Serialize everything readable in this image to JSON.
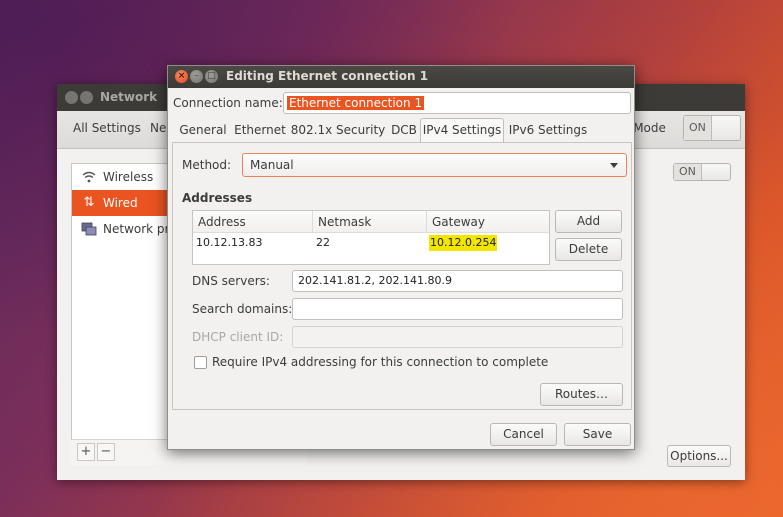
{
  "background_window": {
    "title": "Network",
    "toolbar": {
      "all_settings": "All Settings",
      "ne_fragment": "Ne",
      "mode_fragment": "e Mode",
      "switch_label": "ON"
    },
    "sidebar": [
      {
        "icon": "wifi-icon",
        "label": "Wireless"
      },
      {
        "icon": "wired-arrows-icon",
        "label": "Wired",
        "selected": true
      },
      {
        "icon": "network-proxy-icon",
        "label": "Network pr"
      }
    ],
    "wireless_switch_label": "ON",
    "add_symbol": "+",
    "remove_symbol": "−",
    "options_label": "Options..."
  },
  "dialog": {
    "title": "Editing Ethernet connection 1",
    "connection_name_label": "Connection name:",
    "connection_name_value": "Ethernet connection 1",
    "tabs": [
      {
        "label": "General"
      },
      {
        "label": "Ethernet"
      },
      {
        "label": "802.1x Security"
      },
      {
        "label": "DCB"
      },
      {
        "label": "IPv4 Settings",
        "active": true
      },
      {
        "label": "IPv6 Settings"
      }
    ],
    "method_label": "Method:",
    "method_value": "Manual",
    "addresses_heading": "Addresses",
    "table": {
      "headers": [
        "Address",
        "Netmask",
        "Gateway"
      ],
      "rows": [
        {
          "address": "10.12.13.83",
          "netmask": "22",
          "gateway": "10.12.0.254"
        }
      ]
    },
    "add_label": "Add",
    "delete_label": "Delete",
    "dns_label": "DNS servers:",
    "dns_value": "202.141.81.2, 202.141.80.9",
    "search_label": "Search domains:",
    "search_value": "",
    "dhcp_label": "DHCP client ID:",
    "dhcp_value": "",
    "require_label": "Require IPv4 addressing for this connection to complete",
    "routes_label": "Routes…",
    "cancel_label": "Cancel",
    "save_label": "Save"
  },
  "colors": {
    "accent": "#e95420",
    "highlight": "#f2e600",
    "titlebar": "#3c3b37"
  }
}
